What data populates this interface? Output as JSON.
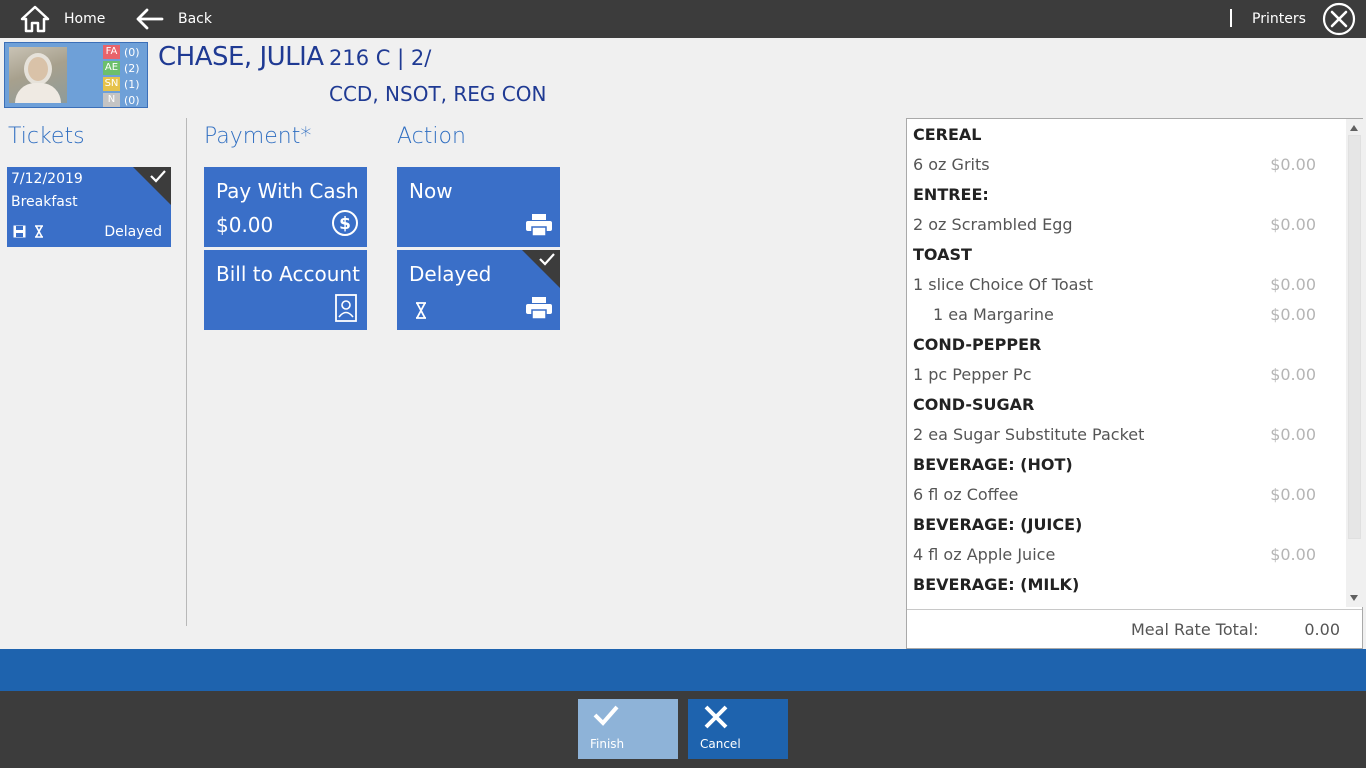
{
  "topbar": {
    "home_label": "Home",
    "back_label": "Back",
    "printers_label": "Printers"
  },
  "resident": {
    "name": "CHASE, JULIA",
    "room": "216 C | 2/",
    "diets": "CCD, NSOT, REG CON",
    "counts": [
      {
        "tag": "FA",
        "value": "(0)",
        "color": "#e8636b"
      },
      {
        "tag": "AE",
        "value": "(2)",
        "color": "#6cbf6c"
      },
      {
        "tag": "SN",
        "value": "(1)",
        "color": "#e6c24a"
      },
      {
        "tag": "N",
        "value": "(0)",
        "color": "#c4c4c4"
      }
    ]
  },
  "sections": {
    "tickets": "Tickets",
    "payment": "Payment*",
    "action": "Action"
  },
  "ticket": {
    "date": "7/12/2019",
    "meal": "Breakfast",
    "status": "Delayed"
  },
  "payment": {
    "cash_label": "Pay With Cash",
    "cash_amount": "$0.00",
    "bill_label": "Bill to Account"
  },
  "action": {
    "now_label": "Now",
    "delayed_label": "Delayed"
  },
  "menu": {
    "rows": [
      {
        "type": "cat",
        "label": "CEREAL",
        "price": ""
      },
      {
        "type": "item",
        "label": "6 oz Grits",
        "price": "$0.00"
      },
      {
        "type": "cat",
        "label": "ENTREE:",
        "price": ""
      },
      {
        "type": "item",
        "label": "2 oz Scrambled Egg",
        "price": "$0.00"
      },
      {
        "type": "cat",
        "label": "TOAST",
        "price": ""
      },
      {
        "type": "item",
        "label": "1 slice Choice Of Toast",
        "price": "$0.00"
      },
      {
        "type": "sub",
        "label": "1 ea Margarine",
        "price": "$0.00"
      },
      {
        "type": "cat",
        "label": "COND-PEPPER",
        "price": ""
      },
      {
        "type": "item",
        "label": "1 pc Pepper Pc",
        "price": "$0.00"
      },
      {
        "type": "cat",
        "label": "COND-SUGAR",
        "price": ""
      },
      {
        "type": "item",
        "label": "2 ea Sugar Substitute Packet",
        "price": "$0.00"
      },
      {
        "type": "cat",
        "label": "BEVERAGE: (HOT)",
        "price": ""
      },
      {
        "type": "item",
        "label": "6 fl oz Coffee",
        "price": "$0.00"
      },
      {
        "type": "cat",
        "label": "BEVERAGE: (JUICE)",
        "price": ""
      },
      {
        "type": "item",
        "label": "4 fl oz Apple Juice",
        "price": "$0.00"
      },
      {
        "type": "cat",
        "label": "BEVERAGE: (MILK)",
        "price": ""
      }
    ],
    "total_label": "Meal Rate Total:",
    "total_value": "0.00"
  },
  "footer": {
    "finish_label": "Finish",
    "cancel_label": "Cancel"
  },
  "colors": {
    "accent": "#3a6fc8",
    "topbar": "#3c3c3c",
    "band": "#1e63ae"
  }
}
